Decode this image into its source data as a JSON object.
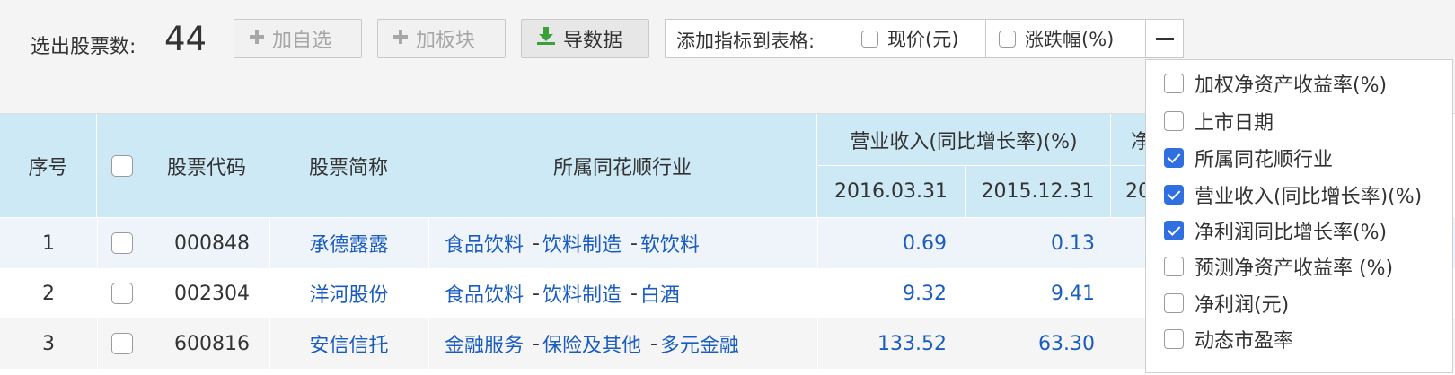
{
  "toolbar": {
    "count_label": "选出股票数:",
    "count_value": "44",
    "add_favorite": "加自选",
    "add_block": "加板块",
    "export": "导数据",
    "indicator_label": "添加指标到表格:",
    "indicator_options": [
      "现价(元)",
      "涨跌幅(%)"
    ]
  },
  "table": {
    "headers": {
      "index": "序号",
      "code": "股票代码",
      "name": "股票简称",
      "industry": "所属同花顺行业",
      "revenue": "营业收入(同比增长率)(%)",
      "net_profit_partial": "净",
      "date1": "2016.03.31",
      "date2": "2015.12.31",
      "date3_partial": "20"
    },
    "rows": [
      {
        "index": "1",
        "code": "000848",
        "name": "承德露露",
        "ind1": "食品饮料",
        "ind2": "饮料制造",
        "ind3": "软饮料",
        "v1": "0.69",
        "v2": "0.13"
      },
      {
        "index": "2",
        "code": "002304",
        "name": "洋河股份",
        "ind1": "食品饮料",
        "ind2": "饮料制造",
        "ind3": "白酒",
        "v1": "9.32",
        "v2": "9.41"
      },
      {
        "index": "3",
        "code": "600816",
        "name": "安信信托",
        "ind1": "金融服务",
        "ind2": "保险及其他",
        "ind3": "多元金融",
        "v1": "133.52",
        "v2": "63.30"
      }
    ]
  },
  "dropdown": {
    "items": [
      {
        "label": "加权净资产收益率(%)",
        "checked": false
      },
      {
        "label": "上市日期",
        "checked": false
      },
      {
        "label": "所属同花顺行业",
        "checked": true
      },
      {
        "label": "营业收入(同比增长率)(%)",
        "checked": true
      },
      {
        "label": "净利润同比增长率(%)",
        "checked": true
      },
      {
        "label": "预测净资产收益率 (%)",
        "checked": false
      },
      {
        "label": "净利润(元)",
        "checked": false
      },
      {
        "label": "动态市盈率",
        "checked": false
      }
    ]
  },
  "colors": {
    "link": "#1a5dbf",
    "header_bg": "#cde9f5",
    "check_blue": "#2f6fe0"
  }
}
